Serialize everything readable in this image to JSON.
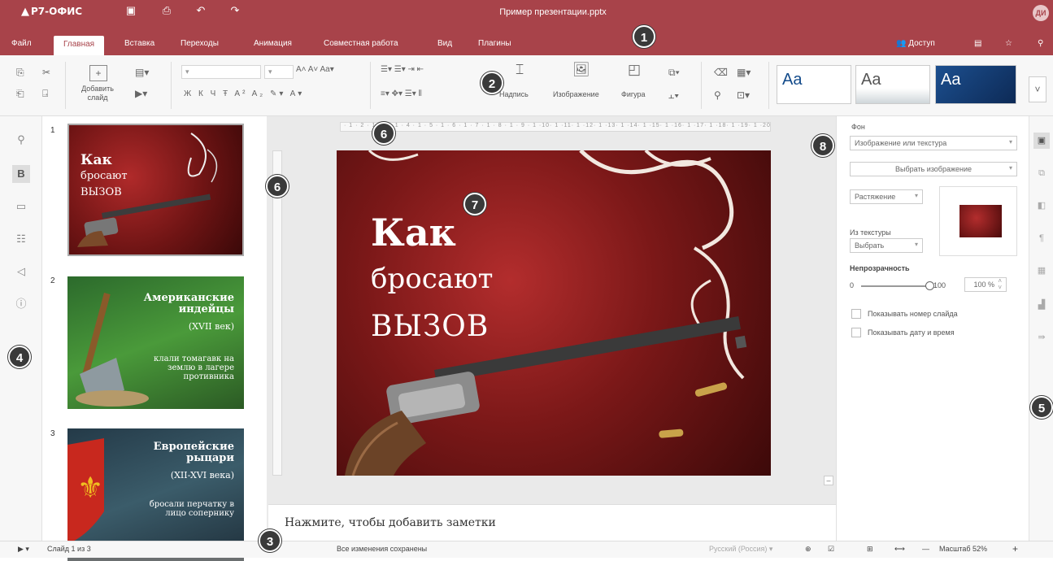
{
  "app": {
    "logo": "Р7-ОФИС",
    "doc_title": "Пример презентации.pptx",
    "avatar": "ДИ"
  },
  "menu": {
    "tabs": [
      "Файл",
      "Главная",
      "Вставка",
      "Переходы",
      "Анимация",
      "Совместная работа",
      "Вид",
      "Плагины"
    ],
    "active": "Главная",
    "access": "Доступ"
  },
  "toolbar": {
    "add_slide": "Добавить слайд",
    "text_label": "Надпись",
    "image_label": "Изображение",
    "shape_label": "Фигура",
    "themes": [
      "Aa",
      "Aa",
      "Aa"
    ]
  },
  "slides": [
    {
      "num": "1",
      "title": "Как",
      "lines": [
        "бросают",
        "вызов"
      ]
    },
    {
      "num": "2",
      "title": "Американские индейцы",
      "sub": "(XVII век)",
      "body": "клали томагавк на землю в лагере противника"
    },
    {
      "num": "3",
      "title": "Европейские рыцари",
      "sub": "(XII-XVI века)",
      "body": "бросали перчатку в лицо сопернику"
    }
  ],
  "main_slide": {
    "title": "Как",
    "line1": "бросают",
    "line2": "вызов"
  },
  "notes": {
    "placeholder": "Нажмите, чтобы добавить заметки"
  },
  "right_panel": {
    "background_label": "Фон",
    "fill_select": "Изображение или текстура",
    "choose_image": "Выбрать изображение",
    "stretch_select": "Растяжение",
    "from_texture_label": "Из текстуры",
    "texture_select": "Выбрать",
    "opacity_label": "Непрозрачность",
    "opacity_min": "0",
    "opacity_max": "100",
    "opacity_value": "100 %",
    "opacity_level": 1.0,
    "show_slide_number": "Показывать номер слайда",
    "show_date_time": "Показывать дату и время"
  },
  "status": {
    "slide_counter": "Слайд 1 из 3",
    "saved": "Все изменения сохранены",
    "language": "Русский (Россия)",
    "zoom": "Масштаб 52%"
  },
  "callouts": [
    "1",
    "2",
    "3",
    "4",
    "5",
    "6",
    "6",
    "7",
    "8"
  ],
  "colors": {
    "accent": "#a8434a",
    "badge": "#3a3a3a"
  }
}
